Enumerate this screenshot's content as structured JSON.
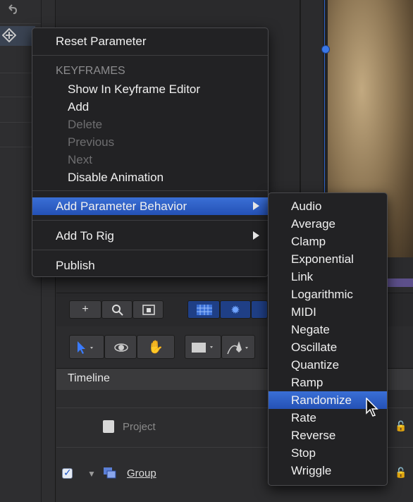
{
  "context_menu": {
    "reset_parameter": "Reset Parameter",
    "keyframes_header": "KEYFRAMES",
    "show_in_keyframe_editor": "Show In Keyframe Editor",
    "add": "Add",
    "delete": "Delete",
    "previous": "Previous",
    "next": "Next",
    "disable_animation": "Disable Animation",
    "add_parameter_behavior": "Add Parameter Behavior",
    "add_to_rig": "Add To Rig",
    "publish": "Publish"
  },
  "submenu": {
    "items": [
      "Audio",
      "Average",
      "Clamp",
      "Exponential",
      "Link",
      "Logarithmic",
      "MIDI",
      "Negate",
      "Oscillate",
      "Quantize",
      "Ramp",
      "Randomize",
      "Rate",
      "Reverse",
      "Stop",
      "Wriggle"
    ],
    "selected": "Randomize"
  },
  "timeline": {
    "header": "Timeline",
    "project_label": "Project",
    "group_label": "Group"
  },
  "colors": {
    "highlight": "#2d5cc4",
    "menu_bg": "#222224",
    "disabled_text": "#6e6e70"
  }
}
